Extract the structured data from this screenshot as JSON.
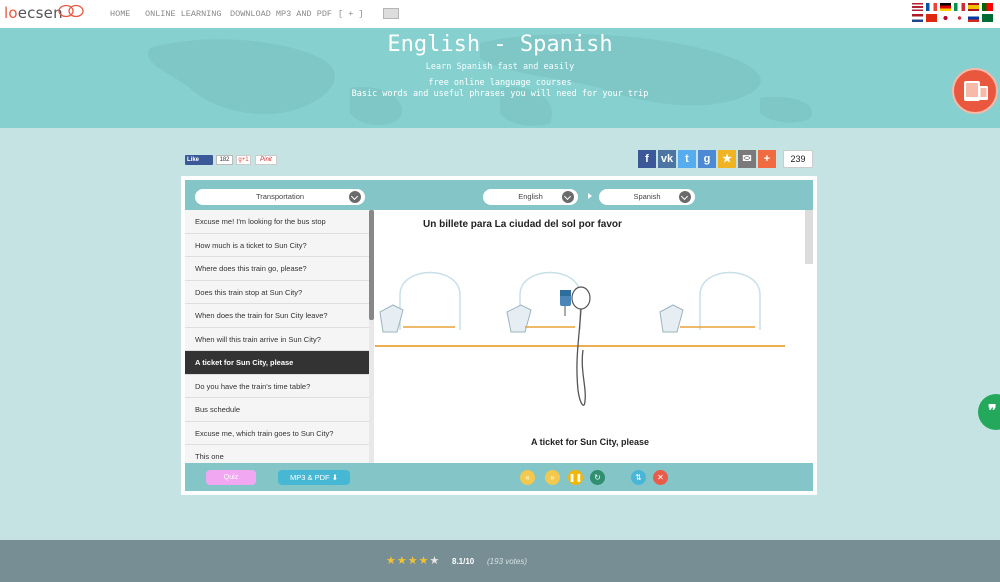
{
  "brand": {
    "logo_lo": "lo",
    "logo_rest": "ecsen"
  },
  "nav": {
    "items": [
      "HOME",
      "ONLINE LEARNING",
      "DOWNLOAD MP3 AND PDF",
      "[ + ]"
    ]
  },
  "hero": {
    "title": "English - Spanish",
    "subtitle": "Learn Spanish fast and easily",
    "line2": "free online language courses",
    "line3": "Basic words and useful phrases you will need for your trip"
  },
  "social": {
    "fb_like": "Like",
    "fb_count": "182",
    "gplus": "g+1",
    "pinit": "Pinit",
    "share_total": "239",
    "share_buttons": [
      {
        "glyph": "f",
        "color": "#3b5998",
        "icon": "facebook-icon"
      },
      {
        "glyph": "vk",
        "color": "#4c75a3",
        "icon": "vk-icon"
      },
      {
        "glyph": "t",
        "color": "#55acee",
        "icon": "twitter-icon"
      },
      {
        "glyph": "g",
        "color": "#4c8bd4",
        "icon": "google-icon"
      },
      {
        "glyph": "★",
        "color": "#f0b323",
        "icon": "star-icon"
      },
      {
        "glyph": "✉",
        "color": "#7a7a7a",
        "icon": "mail-icon"
      },
      {
        "glyph": "+",
        "color": "#f06b3f",
        "icon": "plus-icon"
      }
    ]
  },
  "selectors": {
    "category": "Transportation",
    "from_lang": "English",
    "to_lang": "Spanish"
  },
  "phrases": [
    "Excuse me! I'm looking for the bus stop",
    "How much is a ticket to Sun City?",
    "Where does this train go, please?",
    "Does this train stop at Sun City?",
    "When does the train for Sun City leave?",
    "When will this train arrive in Sun City?",
    "A ticket for Sun City, please",
    "Do you have the train's time table?",
    "Bus schedule",
    "Excuse me, which train goes to Sun City?",
    "This one"
  ],
  "active_index": 6,
  "lesson": {
    "target_phrase": "Un billete para La ciudad del sol por favor",
    "source_phrase": "A ticket for Sun City, please"
  },
  "controls": {
    "quiz": "Quiz",
    "mp3": "MP3 & PDF",
    "buttons": [
      {
        "icon": "rewind-icon",
        "glyph": "«",
        "color": "#f2c94c"
      },
      {
        "icon": "fast-forward-icon",
        "glyph": "»",
        "color": "#f2c94c"
      },
      {
        "icon": "pause-icon",
        "glyph": "❚❚",
        "color": "#f2b705"
      },
      {
        "icon": "repeat-icon",
        "glyph": "↻",
        "color": "#2f8f6f"
      },
      {
        "icon": "swap-icon",
        "glyph": "⇅",
        "color": "#49b6d8"
      },
      {
        "icon": "shuffle-icon",
        "glyph": "✕",
        "color": "#ea5c4a"
      }
    ]
  },
  "rating": {
    "score": "8.1/10",
    "votes": "(193 votes)",
    "stars_full": 4,
    "stars_total": 5
  },
  "colors": {
    "teal": "#84c5c8",
    "hero": "#86d0cf",
    "accent": "#e9573f",
    "footer": "#778f94"
  }
}
